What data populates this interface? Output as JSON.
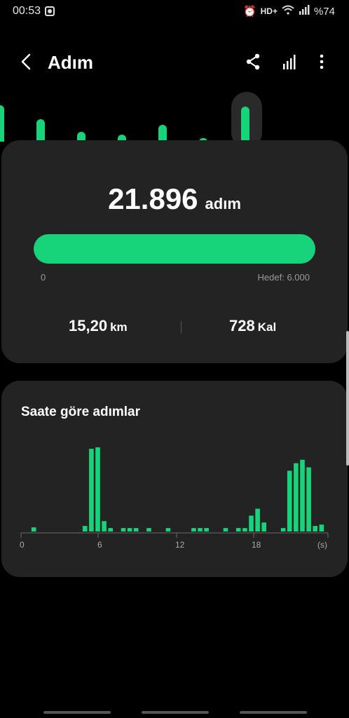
{
  "status_bar": {
    "time": "00:53",
    "network": "HD+",
    "battery": "%74"
  },
  "app_bar": {
    "title": "Adım"
  },
  "summary": {
    "steps": "21.896",
    "steps_unit": "adım",
    "progress_fraction": 1.0,
    "progress_start": "0",
    "goal_label": "Hedef: 6.000",
    "distance_value": "15,20",
    "distance_unit": "km",
    "calories_value": "728",
    "calories_unit": "Kal"
  },
  "daily_bars": {
    "values": [
      0.65,
      0.4,
      0.18,
      0.12,
      0.3,
      0.06,
      0.62
    ],
    "selected_index": 6
  },
  "hourly_chart": {
    "title": "Saate göre adımlar",
    "x_ticks": [
      "0",
      "6",
      "12",
      "18",
      "(s)"
    ]
  },
  "chart_data": {
    "type": "bar",
    "title": "Saate göre adımlar",
    "xlabel": "(s)",
    "x_ticks": [
      "0",
      "6",
      "12",
      "18"
    ],
    "xlim": [
      0,
      24
    ],
    "bar_width_hours": 0.5,
    "x": [
      1,
      5,
      5.5,
      6,
      6.5,
      7,
      8,
      8.5,
      9,
      10,
      11.5,
      13.5,
      14,
      14.5,
      16,
      17,
      17.5,
      18,
      18.5,
      19,
      20.5,
      21,
      21.5,
      22,
      22.5,
      23,
      23.5
    ],
    "values": [
      60,
      80,
      1200,
      1220,
      150,
      50,
      50,
      50,
      50,
      50,
      50,
      50,
      50,
      50,
      50,
      50,
      50,
      230,
      330,
      130,
      50,
      880,
      990,
      1040,
      930,
      80,
      100
    ],
    "colors": {
      "bar": "#17d47a"
    }
  }
}
